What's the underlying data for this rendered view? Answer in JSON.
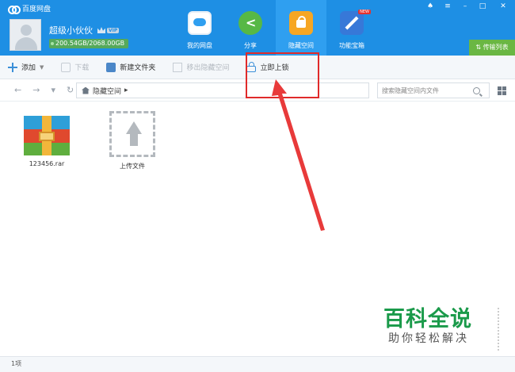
{
  "app": {
    "title": "百度网盘"
  },
  "user": {
    "name": "超级小伙伙",
    "vip_tag": "VIP",
    "quota": "200.54GB/2068.00GB"
  },
  "nav": [
    {
      "label": "我的网盘",
      "icon": "cloud-drive-icon"
    },
    {
      "label": "分享",
      "icon": "share-icon"
    },
    {
      "label": "隐藏空间",
      "icon": "lock-icon",
      "active": true
    },
    {
      "label": "功能宝箱",
      "icon": "tools-icon",
      "badge": "NEW"
    }
  ],
  "transfer_label": "传输列表",
  "toolbar": {
    "add": "添加",
    "download": "下载",
    "new_folder": "新建文件夹",
    "move_out": "移出隐藏空间",
    "lock_now": "立即上锁"
  },
  "breadcrumb": {
    "current": "隐藏空间"
  },
  "search": {
    "placeholder": "搜索隐藏空间内文件"
  },
  "files": [
    {
      "name": "123456.rar",
      "icon": "rar-archive-icon"
    },
    {
      "name": "上传文件",
      "icon": "upload-icon"
    }
  ],
  "watermark": {
    "title": "百科全说",
    "subtitle": "助你轻松解决"
  },
  "status": {
    "count": "1项"
  },
  "colors": {
    "header": "#1e8fe4",
    "accent_red": "#e02a2a",
    "transfer": "#6ab743"
  }
}
